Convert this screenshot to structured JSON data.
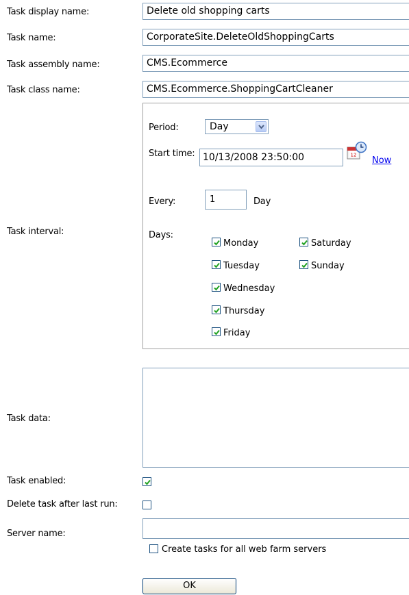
{
  "labels": {
    "display_name": "Task display name:",
    "task_name": "Task name:",
    "assembly_name": "Task assembly name:",
    "class_name": "Task class name:",
    "interval": "Task interval:",
    "task_data": "Task data:",
    "enabled": "Task enabled:",
    "delete_after": "Delete task after last run:",
    "server_name": "Server name:"
  },
  "fields": {
    "display_name": "Delete old shopping carts",
    "task_name": "CorporateSite.DeleteOldShoppingCarts",
    "assembly_name": "CMS.Ecommerce",
    "class_name": "CMS.Ecommerce.ShoppingCartCleaner",
    "task_data": "",
    "server_name": ""
  },
  "interval": {
    "period_label": "Period:",
    "period_value": "Day",
    "start_time_label": "Start time:",
    "start_time_value": "10/13/2008 23:50:00",
    "now_link": "Now",
    "calendar_badge": "12",
    "every_label": "Every:",
    "every_value": "1",
    "every_unit": "Day",
    "days_label": "Days:",
    "days": [
      {
        "name": "Monday",
        "checked": true
      },
      {
        "name": "Tuesday",
        "checked": true
      },
      {
        "name": "Wednesday",
        "checked": true
      },
      {
        "name": "Thursday",
        "checked": true
      },
      {
        "name": "Friday",
        "checked": true
      },
      {
        "name": "Saturday",
        "checked": true
      },
      {
        "name": "Sunday",
        "checked": true
      }
    ]
  },
  "options": {
    "enabled_checked": true,
    "delete_after_checked": false,
    "web_farm_label": "Create tasks for all web farm servers",
    "web_farm_checked": false
  },
  "ok_button": "OK",
  "colors": {
    "check_green": "#21a121",
    "link_blue": "#0000ee",
    "border_blue": "#7f9db9"
  }
}
